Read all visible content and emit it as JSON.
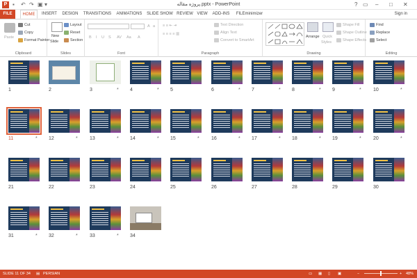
{
  "window": {
    "title": "پروژه مقاله.pptx - PowerPoint",
    "app_icon": "P",
    "signin": "Sign in",
    "help_glyph": "?"
  },
  "quick_access": {
    "save_icon": "save-icon",
    "undo_icon": "undo-icon",
    "redo_icon": "redo-icon",
    "start_icon": "start-from-beginning-icon"
  },
  "tabs": [
    {
      "label": "FILE"
    },
    {
      "label": "HOME"
    },
    {
      "label": "INSERT"
    },
    {
      "label": "DESIGN"
    },
    {
      "label": "TRANSITIONS"
    },
    {
      "label": "ANIMATIONS"
    },
    {
      "label": "SLIDE SHOW"
    },
    {
      "label": "REVIEW"
    },
    {
      "label": "VIEW"
    },
    {
      "label": "ADD-INS"
    },
    {
      "label": "FILEminimizer"
    }
  ],
  "ribbon": {
    "clipboard": {
      "label": "Clipboard",
      "paste": "Paste",
      "cut": "Cut",
      "copy": "Copy",
      "format_painter": "Format Painter"
    },
    "slides": {
      "label": "Slides",
      "new_slide": "New",
      "new_slide2": "Slide",
      "layout": "Layout",
      "reset": "Reset",
      "section": "Section"
    },
    "font": {
      "label": "Font",
      "font_size": "",
      "font_name": ""
    },
    "paragraph": {
      "label": "Paragraph",
      "text_direction": "Text Direction",
      "align_text": "Align Text",
      "convert_smartart": "Convert to SmartArt"
    },
    "drawing": {
      "label": "Drawing",
      "arrange": "Arrange",
      "quick_styles": "Quick",
      "quick_styles2": "Styles",
      "shape_fill": "Shape Fill",
      "shape_outline": "Shape Outline",
      "shape_effects": "Shape Effects"
    },
    "editing": {
      "label": "Editing",
      "find": "Find",
      "replace": "Replace",
      "select": "Select"
    }
  },
  "slides": [
    {
      "num": "1",
      "star": "",
      "variant": "title"
    },
    {
      "num": "2",
      "star": "",
      "variant": "bluecard"
    },
    {
      "num": "3",
      "star": "*",
      "variant": "light"
    },
    {
      "num": "4",
      "star": "*",
      "variant": "books"
    },
    {
      "num": "5",
      "star": "",
      "variant": "books"
    },
    {
      "num": "6",
      "star": "*",
      "variant": "books"
    },
    {
      "num": "7",
      "star": "*",
      "variant": "books"
    },
    {
      "num": "8",
      "star": "*",
      "variant": "books"
    },
    {
      "num": "9",
      "star": "*",
      "variant": "books"
    },
    {
      "num": "10",
      "star": "*",
      "variant": "books"
    },
    {
      "num": "11",
      "star": "*",
      "variant": "books"
    },
    {
      "num": "12",
      "star": "*",
      "variant": "books"
    },
    {
      "num": "13",
      "star": "*",
      "variant": "books"
    },
    {
      "num": "14",
      "star": "*",
      "variant": "books"
    },
    {
      "num": "15",
      "star": "*",
      "variant": "books"
    },
    {
      "num": "16",
      "star": "*",
      "variant": "books"
    },
    {
      "num": "17",
      "star": "*",
      "variant": "books"
    },
    {
      "num": "18",
      "star": "*",
      "variant": "books"
    },
    {
      "num": "19",
      "star": "*",
      "variant": "books"
    },
    {
      "num": "20",
      "star": "*",
      "variant": "books"
    },
    {
      "num": "21",
      "star": "",
      "variant": "books"
    },
    {
      "num": "22",
      "star": "",
      "variant": "books"
    },
    {
      "num": "23",
      "star": "",
      "variant": "books"
    },
    {
      "num": "24",
      "star": "",
      "variant": "books"
    },
    {
      "num": "25",
      "star": "",
      "variant": "books"
    },
    {
      "num": "26",
      "star": "",
      "variant": "books"
    },
    {
      "num": "27",
      "star": "",
      "variant": "books"
    },
    {
      "num": "28",
      "star": "",
      "variant": "books"
    },
    {
      "num": "29",
      "star": "",
      "variant": "books"
    },
    {
      "num": "30",
      "star": "",
      "variant": "books"
    },
    {
      "num": "31",
      "star": "*",
      "variant": "books"
    },
    {
      "num": "32",
      "star": "*",
      "variant": "books"
    },
    {
      "num": "33",
      "star": "*",
      "variant": "books"
    },
    {
      "num": "34",
      "star": "",
      "variant": "photo"
    }
  ],
  "selected_slide": "11",
  "status": {
    "slide_info": "SLIDE 11 OF 34",
    "language": "PERSIAN",
    "zoom": "48%",
    "minus": "−",
    "plus": "+"
  },
  "colors": {
    "accent": "#d24726",
    "selection": "#e0613a"
  }
}
